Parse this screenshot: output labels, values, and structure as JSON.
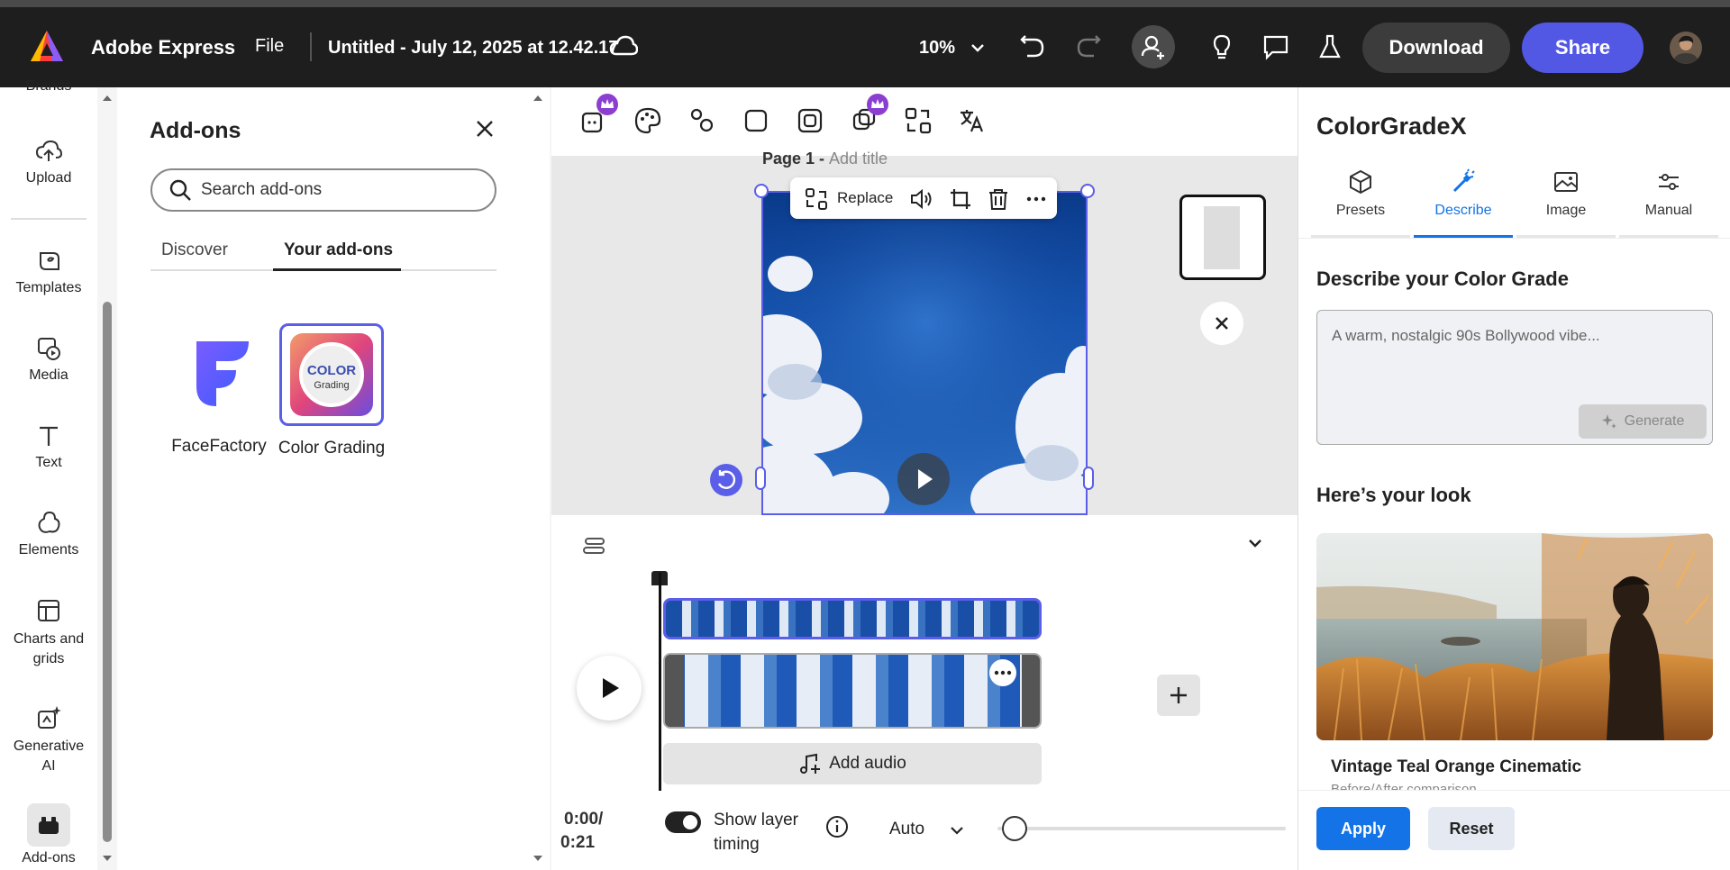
{
  "topbar": {
    "app_name": "Adobe Express",
    "file_menu": "File",
    "doc_title": "Untitled - July 12, 2025 at 12.42.17",
    "zoom": "10%",
    "download_label": "Download",
    "share_label": "Share"
  },
  "leftrail": {
    "brands_label": "Brands",
    "items": [
      {
        "label": "Upload",
        "icon": "upload-icon"
      },
      {
        "label": "Templates",
        "icon": "templates-icon"
      },
      {
        "label": "Media",
        "icon": "media-icon"
      },
      {
        "label": "Text",
        "icon": "text-icon"
      },
      {
        "label": "Elements",
        "icon": "elements-icon"
      },
      {
        "label": "Charts and grids",
        "icon": "charts-icon"
      },
      {
        "label": "Generative AI",
        "icon": "generative-ai-icon"
      },
      {
        "label": "Add-ons",
        "icon": "add-ons-icon"
      }
    ]
  },
  "addons": {
    "title": "Add-ons",
    "search_placeholder": "Search add-ons",
    "tabs": [
      "Discover",
      "Your add-ons"
    ],
    "active_tab": "Your add-ons",
    "items": [
      {
        "name": "FaceFactory"
      },
      {
        "name": "Color Grading",
        "logo_text_1": "COLOR",
        "logo_text_2": "Grading"
      }
    ]
  },
  "canvas": {
    "page_label": "Page 1 - ",
    "page_title_placeholder": "Add title",
    "replace_label": "Replace"
  },
  "timeline": {
    "add_audio": "Add audio",
    "time_current": "0:00/",
    "time_total": "0:21",
    "show_layer_timing": "Show layer timing",
    "speed": "Auto"
  },
  "rightpanel": {
    "title": "ColorGradeX",
    "tabs": [
      {
        "label": "Presets",
        "icon": "cube-icon"
      },
      {
        "label": "Describe",
        "icon": "magic-wand-icon"
      },
      {
        "label": "Image",
        "icon": "image-icon"
      },
      {
        "label": "Manual",
        "icon": "sliders-icon"
      }
    ],
    "active_tab": "Describe",
    "describe_heading": "Describe your Color Grade",
    "describe_placeholder": "A warm, nostalgic 90s Bollywood vibe...",
    "generate_label": "Generate",
    "look_heading": "Here’s your look",
    "look_name": "Vintage Teal Orange Cinematic",
    "look_sub": "Before/After comparison",
    "apply_label": "Apply",
    "reset_label": "Reset"
  },
  "colors": {
    "accent": "#5258e4",
    "blue": "#1473e6",
    "topbar_bg": "#1e1e1e"
  }
}
